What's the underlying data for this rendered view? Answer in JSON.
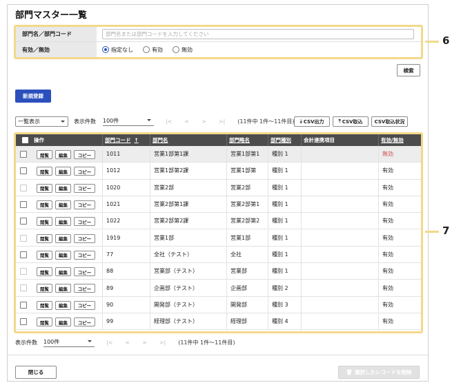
{
  "page": {
    "title": "部門マスター一覧"
  },
  "search": {
    "dept_label": "部門名／部門コード",
    "dept_placeholder": "部門名または部門コードを入力してください",
    "valid_label": "有効／無効",
    "radio_options": [
      "指定なし",
      "有効",
      "無効"
    ],
    "radio_selected": "指定なし",
    "search_button": "検索"
  },
  "callouts": {
    "search": "6",
    "table": "7"
  },
  "toolbar": {
    "new_button": "新規登録",
    "view_select": "一覧表示",
    "page_size_label": "表示件数",
    "page_size_value": "100件",
    "pager": {
      "first": "|<",
      "prev": "<",
      "next": ">",
      "last": ">|",
      "info": "(11件中 1件〜11件目)"
    },
    "csv_out": "CSV出力",
    "csv_in": "CSV取込",
    "csv_status": "CSV取込状況"
  },
  "table": {
    "headers": {
      "ops": "操作",
      "code": "部門コード",
      "name": "部門名",
      "short": "部門略名",
      "type": "部門種別",
      "account": "会計連携項目",
      "valid": "有効/無効"
    },
    "sort_indicator": "↑",
    "op_labels": {
      "view": "閲覧",
      "edit": "編集",
      "copy": "コピー"
    },
    "rows": [
      {
        "code": "1011",
        "name": "営業1部第1課",
        "short": "営業1部第1",
        "type": "種別 1",
        "account": "",
        "valid": "無効"
      },
      {
        "code": "1012",
        "name": "営業1部第2課",
        "short": "営業1部第",
        "type": "種別 1",
        "account": "",
        "valid": "有効"
      },
      {
        "code": "1020",
        "name": "営業2部",
        "short": "営業2部",
        "type": "種別 1",
        "account": "",
        "valid": "有効"
      },
      {
        "code": "1021",
        "name": "営業2部第1課",
        "short": "営業2部第1",
        "type": "種別 1",
        "account": "",
        "valid": "有効"
      },
      {
        "code": "1022",
        "name": "営業2部第2課",
        "short": "営業2部第2",
        "type": "種別 1",
        "account": "",
        "valid": "有効"
      },
      {
        "code": "1919",
        "name": "営業1部",
        "short": "営業1部",
        "type": "種別 1",
        "account": "",
        "valid": "有効"
      },
      {
        "code": "77",
        "name": "全社（テスト）",
        "short": "全社",
        "type": "種別 1",
        "account": "",
        "valid": "有効"
      },
      {
        "code": "88",
        "name": "営業部（テスト）",
        "short": "営業部",
        "type": "種別 1",
        "account": "",
        "valid": "有効"
      },
      {
        "code": "89",
        "name": "企画部（テスト）",
        "short": "企画部",
        "type": "種別 2",
        "account": "",
        "valid": "有効"
      },
      {
        "code": "90",
        "name": "開発部（テスト）",
        "short": "開発部",
        "type": "種別 3",
        "account": "",
        "valid": "有効"
      },
      {
        "code": "99",
        "name": "経理部（テスト）",
        "short": "経理部",
        "type": "種別 4",
        "account": "",
        "valid": "有効"
      }
    ]
  },
  "footer": {
    "page_size_label": "表示件数",
    "page_size_value": "100件",
    "info": "(11件中 1件〜11件目)",
    "close_button": "閉じる",
    "delete_button": "選択したレコードを削除"
  },
  "colors": {
    "primary": "#2b4fbd",
    "callout": "#f3d88a",
    "header_bg": "#4c4c4c",
    "invalid_text": "#d04a4a"
  }
}
